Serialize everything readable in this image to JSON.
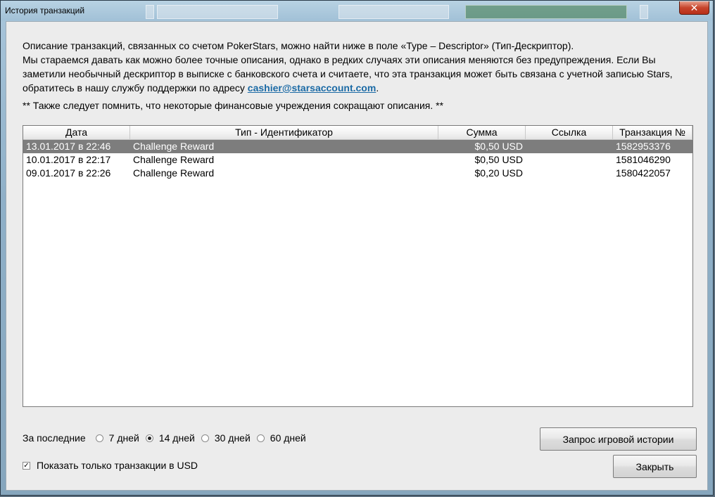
{
  "window": {
    "title": "История транзакций",
    "close_glyph": "✕"
  },
  "description": {
    "line1": "Описание транзакций, связанных со счетом PokerStars, можно найти ниже в поле «Type – Descriptor» (Тип-Дескриптор).",
    "line2_prefix": "Мы стараемся давать как можно более точные описания, однако в редких случаях эти описания меняются без предупреждения. Если Вы заметили необычный дескриптор в выписке с банковского счета и считаете, что эта транзакция может быть связана с учетной записью Stars, обратитесь в нашу службу поддержки по адресу ",
    "email": "cashier@starsaccount.com",
    "line2_suffix": ".",
    "note": "** Также следует помнить, что некоторые финансовые учреждения сокращают описания. **"
  },
  "table": {
    "columns": [
      "Дата",
      "Тип - Идентификатор",
      "Сумма",
      "Ссылка",
      "Транзакция №"
    ],
    "rows": [
      {
        "date": "13.01.2017 в 22:46",
        "type": "Challenge Reward",
        "amount": "$0,50 USD",
        "reference": "",
        "transaction": "1582953376",
        "selected": true
      },
      {
        "date": "10.01.2017 в 22:17",
        "type": "Challenge Reward",
        "amount": "$0,50 USD",
        "reference": "",
        "transaction": "1581046290",
        "selected": false
      },
      {
        "date": "09.01.2017 в 22:26",
        "type": "Challenge Reward",
        "amount": "$0,20 USD",
        "reference": "",
        "transaction": "1580422057",
        "selected": false
      }
    ]
  },
  "filter": {
    "label": "За последние",
    "options": [
      {
        "label": "7 дней",
        "checked": false
      },
      {
        "label": "14 дней",
        "checked": true
      },
      {
        "label": "30 дней",
        "checked": false
      },
      {
        "label": "60 дней",
        "checked": false
      }
    ]
  },
  "usd_only": {
    "label": "Показать только транзакции в USD",
    "checked": true,
    "check_glyph": "✓"
  },
  "buttons": {
    "history": "Запрос игровой истории",
    "close": "Закрыть"
  },
  "colors": {
    "selected_row": "#7d7d7d",
    "link": "#1b6aa5",
    "close_button": "#c7442b"
  }
}
